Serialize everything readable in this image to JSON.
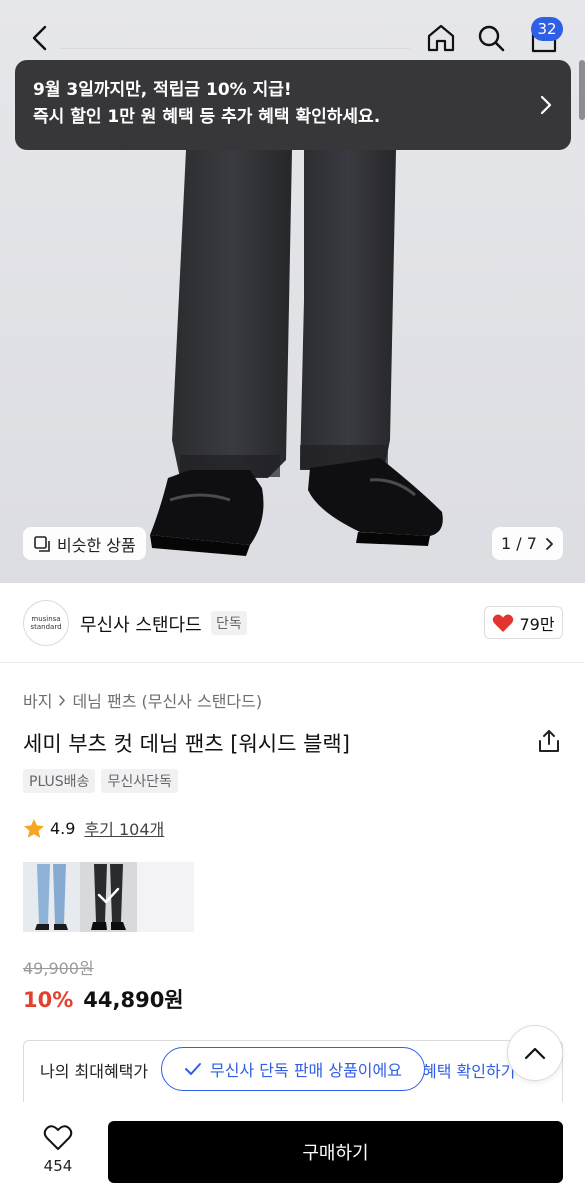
{
  "header": {
    "cart_count": "32"
  },
  "banner": {
    "line1": "9월 3일까지만, 적립금 10% 지급!",
    "line2": "즉시 할인 1만 원 혜택 등 추가 혜택 확인하세요."
  },
  "gallery": {
    "similar_label": "비슷한 상품",
    "page_indicator": "1 / 7"
  },
  "brand": {
    "logo_line1": "musinsa",
    "logo_line2": "standard",
    "name": "무신사 스탠다드",
    "exclusive_tag": "단독",
    "likes": "79만"
  },
  "product": {
    "breadcrumb": [
      "바지",
      "데님 팬츠 (무신사 스탠다드)"
    ],
    "title": "세미 부츠 컷 데님 팬츠 [워시드 블랙]",
    "tags": [
      "PLUS배송",
      "무신사단독"
    ],
    "rating": "4.9",
    "reviews": "후기 104개",
    "original_price": "49,900원",
    "discount": "10%",
    "price": "44,890원"
  },
  "benefit": {
    "text": "나의 최대혜택가",
    "link": "혜택 확인하기",
    "toast": "무신사 단독 판매 상품이에요"
  },
  "bottom": {
    "wish_count": "454",
    "buy_label": "구매하기"
  },
  "colors": {
    "accent_blue": "#2f5fe6",
    "discount_red": "#e2412f",
    "heart_red": "#e3342f",
    "star": "#f5a623"
  }
}
